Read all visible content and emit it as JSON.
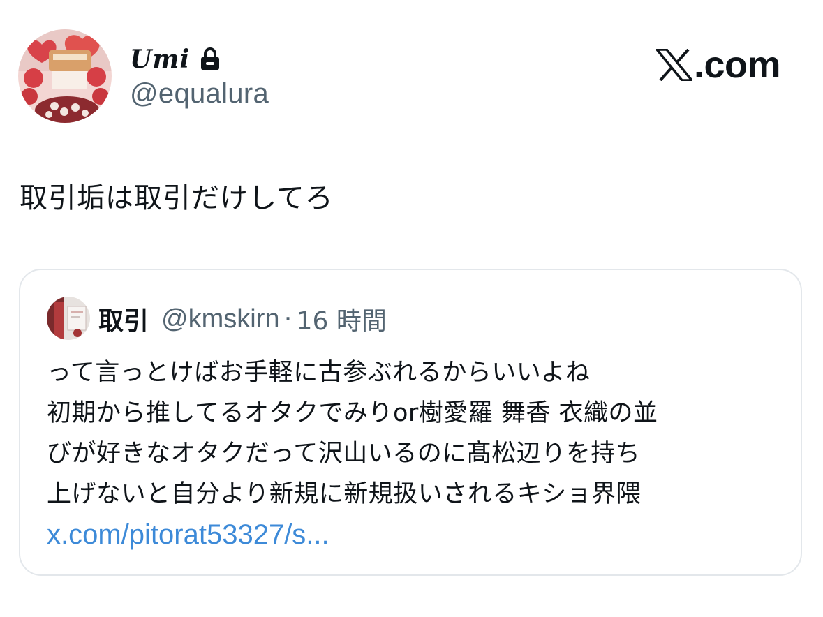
{
  "author": {
    "display_name": "Umi",
    "handle": "@equalura",
    "avatar_icon": "balloon-flower-stand-avatar",
    "lock_icon": "lock-icon"
  },
  "brand": {
    "logo_icon": "x-logo-icon",
    "text": ".com"
  },
  "tweet": {
    "text": "取引垢は取引だけしてろ"
  },
  "quoted_tweet": {
    "name": "取引",
    "handle": "@kmskirn",
    "separator": "·",
    "time": "16 時間",
    "lines": [
      "って言っとけばお手軽に古参ぶれるからいいよね",
      "初期から推してるオタクでみりor樹愛羅 舞香 衣織の並",
      "びが好きなオタクだって沢山いるのに髙松辺りを持ち",
      "上げないと自分より新規に新規扱いされるキショ界隈"
    ],
    "link": "x.com/pitorat53327/s..."
  },
  "colors": {
    "text_primary": "#0f1419",
    "text_secondary": "#536471",
    "link": "#3d8ad8",
    "card_border": "#e3e7eb"
  }
}
